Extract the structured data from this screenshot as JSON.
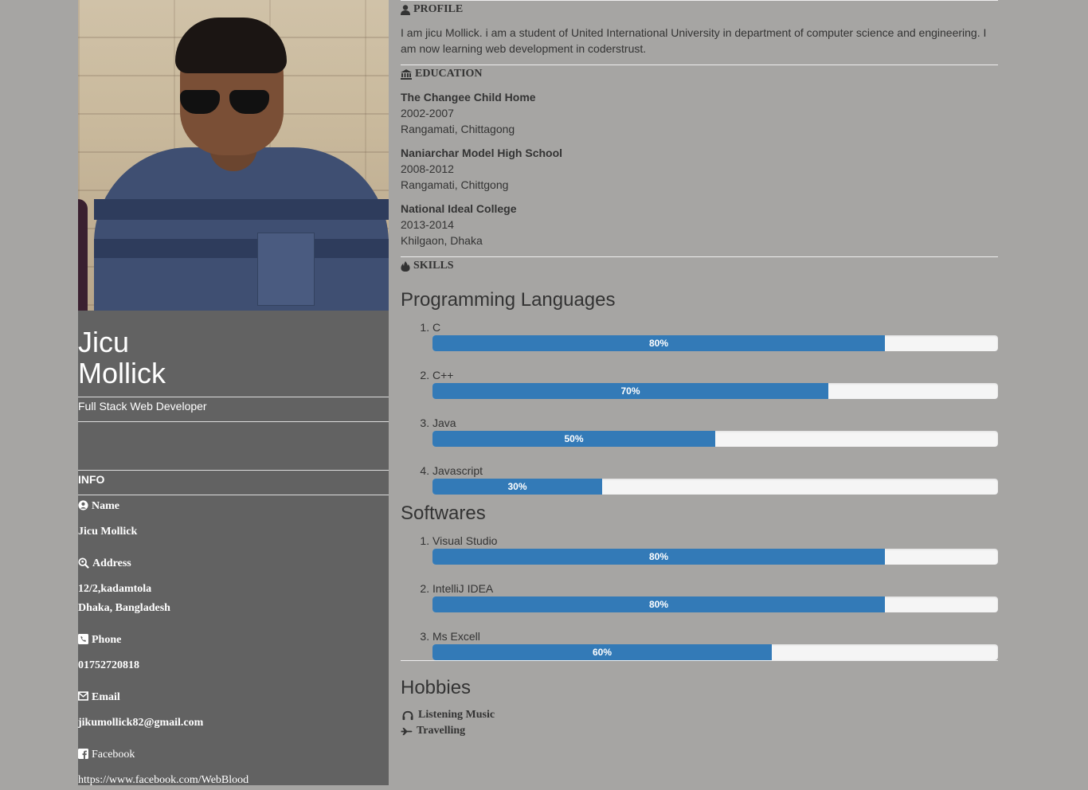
{
  "profile_card": {
    "first_name": "Jicu",
    "last_name": "Mollick",
    "title": "Full Stack Web Developer",
    "info_heading": "INFO",
    "name_label": "Name",
    "name_value": "Jicu Mollick",
    "address_label": "Address",
    "address_line1": "12/2,kadamtola",
    "address_line2": "Dhaka, Bangladesh",
    "phone_label": "Phone",
    "phone_value": "01752720818",
    "email_label": "Email",
    "email_value": "jikumollick82@gmail.com",
    "facebook_label": "Facebook",
    "facebook_value": "https://www.facebook.com/WebBlood"
  },
  "profile": {
    "heading": "PROFILE",
    "text": "I am jicu Mollick. i am a student of United International University in department of computer science and engineering. I am now learning web development in coderstrust."
  },
  "education": {
    "heading": "EDUCATION",
    "items": [
      {
        "school": "The Changee Child Home",
        "years": "2002-2007",
        "place": "Rangamati, Chittagong"
      },
      {
        "school": "Naniarchar Model High School",
        "years": "2008-2012",
        "place": "Rangamati, Chittgong"
      },
      {
        "school": "National Ideal College",
        "years": "2013-2014",
        "place": "Khilgaon, Dhaka"
      }
    ]
  },
  "skills": {
    "heading": "SKILLS",
    "programming_title": "Programming Languages",
    "programming": [
      {
        "name": "C",
        "percent": 80,
        "label": "80%"
      },
      {
        "name": "C++",
        "percent": 70,
        "label": "70%"
      },
      {
        "name": "Java",
        "percent": 50,
        "label": "50%"
      },
      {
        "name": "Javascript",
        "percent": 30,
        "label": "30%"
      }
    ],
    "software_title": "Softwares",
    "software": [
      {
        "name": "Visual Studio",
        "percent": 80,
        "label": "80%"
      },
      {
        "name": "IntelliJ IDEA",
        "percent": 80,
        "label": "80%"
      },
      {
        "name": "Ms Excell",
        "percent": 60,
        "label": "60%"
      }
    ]
  },
  "hobbies": {
    "title": "Hobbies",
    "items": [
      "Listening Music",
      "Travelling"
    ]
  },
  "colors": {
    "page_bg": "#a6a5a3",
    "sidebar_bg": "#626262",
    "bar_fill": "#337ab7",
    "bar_track": "#f5f5f5"
  },
  "icons": [
    "user-icon",
    "bank-icon",
    "fire-icon",
    "user-circle-icon",
    "search-location-icon",
    "phone-square-icon",
    "envelope-icon",
    "facebook-square-icon",
    "headphones-icon",
    "plane-icon"
  ]
}
